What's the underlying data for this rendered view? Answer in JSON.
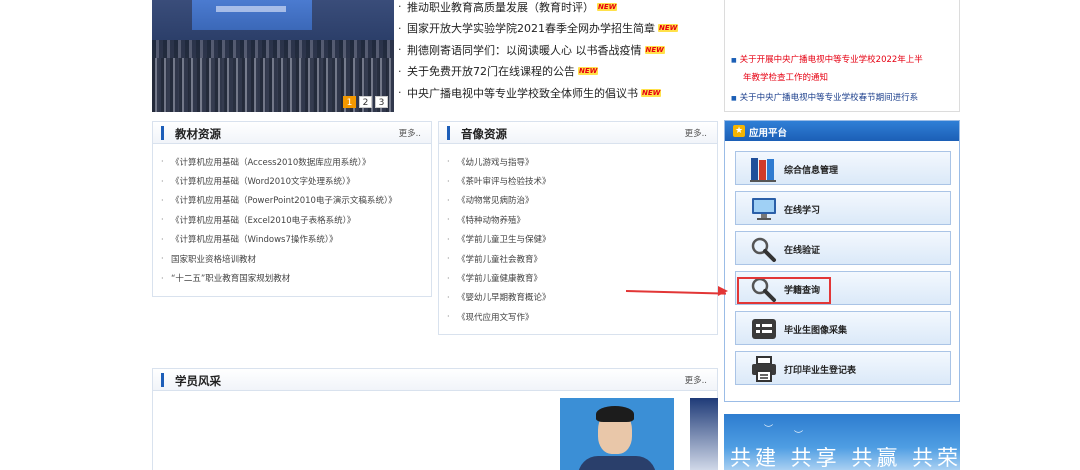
{
  "news": {
    "items": [
      {
        "text": "推动职业教育高质量发展（教育时评）",
        "badge": "NEW"
      },
      {
        "text": "国家开放大学实验学院2021春季全网办学招生简章",
        "badge": "NEW"
      },
      {
        "text": "荆德刚寄语同学们：以阅读暖人心 以书香战疫情",
        "badge": "NEW"
      },
      {
        "text": "关于免费开放72门在线课程的公告",
        "badge": "NEW"
      },
      {
        "text": "中央广播电视中等专业学校致全体师生的倡议书",
        "badge": "NEW"
      }
    ],
    "bullet": "·",
    "pager": [
      "1",
      "2",
      "3"
    ]
  },
  "notices": [
    {
      "text": "关于开展中央广播电视中等专业学校2022年上半",
      "color": "#e60012"
    },
    {
      "text": "年教学检查工作的通知",
      "color": "#e60012"
    },
    {
      "text": "关于中央广播电视中等专业学校春节期间进行系",
      "color": "#1c3f8c"
    }
  ],
  "textbooks": {
    "title": "教材资源",
    "more": "更多..",
    "items": [
      "《计算机应用基础（Access2010数据库应用系统）》",
      "《计算机应用基础（Word2010文字处理系统）》",
      "《计算机应用基础（PowerPoint2010电子演示文稿系统）》",
      "《计算机应用基础（Excel2010电子表格系统）》",
      "《计算机应用基础（Windows7操作系统）》",
      "国家职业资格培训教材",
      "“十二五”职业教育国家规划教材"
    ]
  },
  "media": {
    "title": "音像资源",
    "more": "更多..",
    "items": [
      "《幼儿游戏与指导》",
      "《茶叶审评与检验技术》",
      "《动物常见病防治》",
      "《特种动物养殖》",
      "《学前儿童卫生与保健》",
      "《学前儿童社会教育》",
      "《学前儿童健康教育》",
      "《婴幼儿早期教育概论》",
      "《现代应用文写作》"
    ]
  },
  "app_platform": {
    "title": "应用平台",
    "buttons": [
      {
        "label": "综合信息管理",
        "icon": "books-icon"
      },
      {
        "label": "在线学习",
        "icon": "monitor-icon"
      },
      {
        "label": "在线验证",
        "icon": "magnifier-icon"
      },
      {
        "label": "学籍查询",
        "icon": "magnifier-icon"
      },
      {
        "label": "毕业生图像采集",
        "icon": "form-list-icon"
      },
      {
        "label": "打印毕业生登记表",
        "icon": "printer-icon"
      }
    ]
  },
  "students": {
    "title": "学员风采",
    "more": "更多.."
  },
  "banner": {
    "text": "共建 共享 共赢 共荣"
  },
  "colors": {
    "accent_blue": "#1d5eb8",
    "highlight_red": "#e23636",
    "new_badge_yellow": "#ffe14a"
  }
}
